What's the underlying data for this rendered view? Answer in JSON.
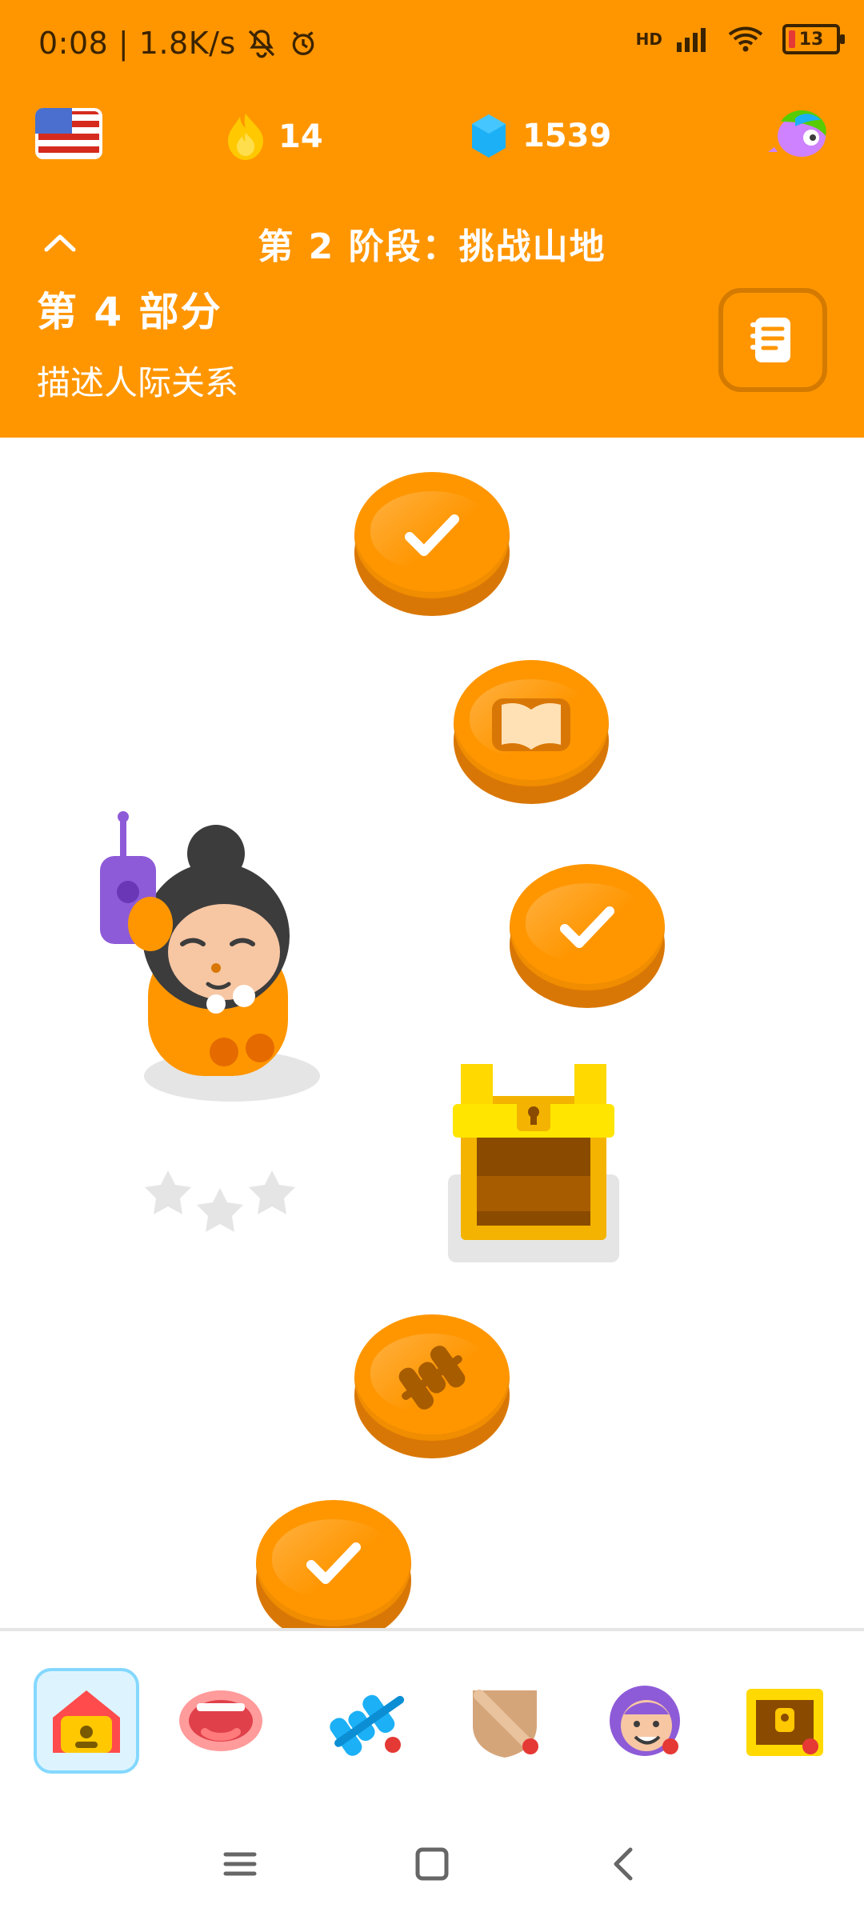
{
  "status_bar": {
    "time_speed": "0:08 | 1.8K/s",
    "network_label": "HD",
    "battery_level": "13"
  },
  "header": {
    "streak_count": "14",
    "gems_count": "1539",
    "stage_title": "第 2 阶段：挑战山地"
  },
  "section": {
    "title": "第 4 部分",
    "subtitle": "描述人际关系"
  },
  "path": {
    "nodes": [
      {
        "type": "check"
      },
      {
        "type": "book"
      },
      {
        "type": "check"
      },
      {
        "type": "chest"
      },
      {
        "type": "dumbbell"
      },
      {
        "type": "check"
      }
    ]
  },
  "bottom_nav": {
    "items": [
      {
        "name": "home"
      },
      {
        "name": "speak"
      },
      {
        "name": "practice"
      },
      {
        "name": "leagues"
      },
      {
        "name": "profile"
      },
      {
        "name": "shop"
      }
    ]
  },
  "colors": {
    "primary": "#FF9600",
    "primary_dark": "#D97706",
    "home_bg": "#DDF4FF",
    "home_border": "#84D8FF",
    "badge": "#E53935"
  }
}
